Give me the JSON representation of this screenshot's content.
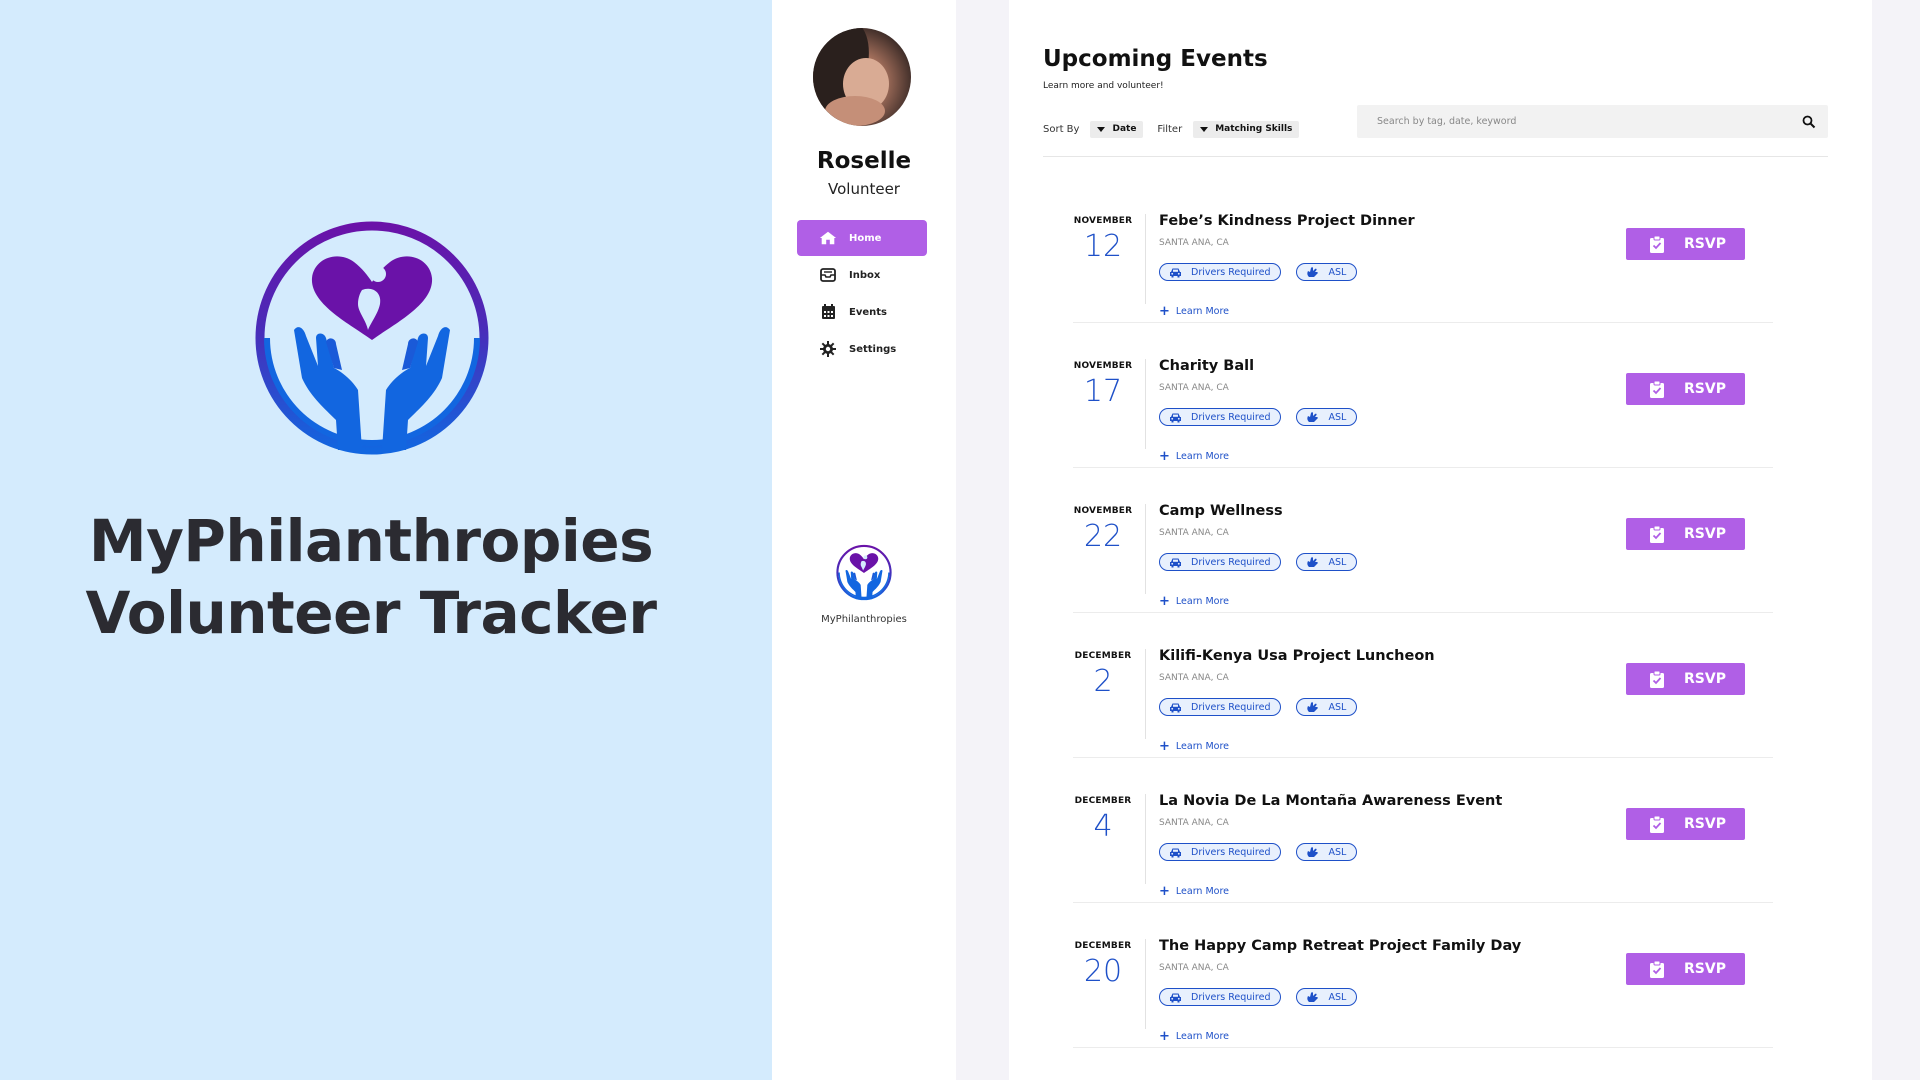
{
  "brand": {
    "title_line1": "MyPhilanthropies",
    "title_line2": "Volunteer Tracker",
    "panel_color": "#d4ebfd"
  },
  "sidebar": {
    "user_name": "Roselle",
    "user_role": "Volunteer",
    "nav": [
      {
        "label": "Home",
        "icon": "home-icon",
        "active": true
      },
      {
        "label": "Inbox",
        "icon": "inbox-icon",
        "active": false
      },
      {
        "label": "Events",
        "icon": "calendar-icon",
        "active": false
      },
      {
        "label": "Settings",
        "icon": "gear-icon",
        "active": false
      }
    ],
    "logo_label": "MyPhilanthropies"
  },
  "main": {
    "title": "Upcoming Events",
    "subtitle": "Learn more and volunteer!",
    "sort_label": "Sort By",
    "sort_value": "Date",
    "filter_label": "Filter",
    "filter_value": "Matching Skills",
    "search_placeholder": "Search by tag, date, keyword"
  },
  "events": [
    {
      "month": "NOVEMBER",
      "day": "12",
      "title": "Febe’s Kindness Project Dinner",
      "location": "SANTA ANA, CA",
      "tags": [
        "Drivers Required",
        "ASL"
      ],
      "learn_more": "Learn More",
      "rsvp": "RSVP"
    },
    {
      "month": "NOVEMBER",
      "day": "17",
      "title": "Charity Ball",
      "location": "SANTA ANA, CA",
      "tags": [
        "Drivers Required",
        "ASL"
      ],
      "learn_more": "Learn More",
      "rsvp": "RSVP"
    },
    {
      "month": "NOVEMBER",
      "day": "22",
      "title": "Camp Wellness",
      "location": "SANTA ANA, CA",
      "tags": [
        "Drivers Required",
        "ASL"
      ],
      "learn_more": "Learn More",
      "rsvp": "RSVP"
    },
    {
      "month": "DECEMBER",
      "day": "2",
      "title": "Kilifi-Kenya Usa Project Luncheon",
      "location": "SANTA ANA, CA",
      "tags": [
        "Drivers Required",
        "ASL"
      ],
      "learn_more": "Learn More",
      "rsvp": "RSVP"
    },
    {
      "month": "DECEMBER",
      "day": "4",
      "title": "La Novia De La Montaña Awareness Event",
      "location": "SANTA ANA, CA",
      "tags": [
        "Drivers Required",
        "ASL"
      ],
      "learn_more": "Learn More",
      "rsvp": "RSVP"
    },
    {
      "month": "DECEMBER",
      "day": "20",
      "title": "The Happy Camp Retreat Project Family Day",
      "location": "SANTA ANA, CA",
      "tags": [
        "Drivers Required",
        "ASL"
      ],
      "learn_more": "Learn More",
      "rsvp": "RSVP"
    }
  ],
  "colors": {
    "accent_purple": "#b05fe6",
    "accent_blue": "#1e50c8",
    "logo_purple": "#6a12a8",
    "logo_blue": "#1266e0"
  }
}
